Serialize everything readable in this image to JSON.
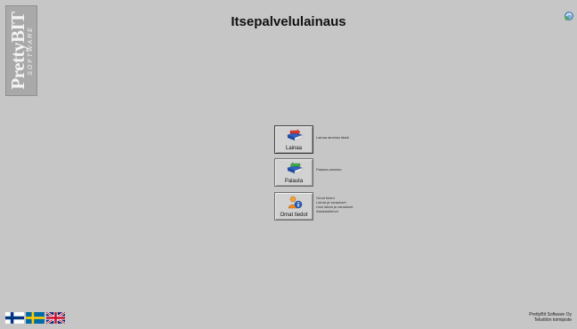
{
  "header": {
    "title": "Itsepalvelulainaus"
  },
  "logo": {
    "name": "PrettyBIT",
    "sub": "SOFTWARE",
    "icon": "prettybit-logo"
  },
  "toolbar": {
    "refresh_icon": "refresh-icon"
  },
  "actions": [
    {
      "label": "Lainaa",
      "icon": "book-arrow-icon",
      "description": [
        "Lainaa aineisto tästä"
      ]
    },
    {
      "label": "Palauta",
      "icon": "book-return-icon",
      "description": [
        "Palauta aineisto"
      ]
    },
    {
      "label": "Omat tiedot",
      "icon": "user-info-icon",
      "description": [
        "Omat tiedot",
        "Lainat ja varaukset",
        "Uusi lainat ja varaukset",
        "Asiakastietoni"
      ]
    }
  ],
  "languages": [
    {
      "code": "fi",
      "icon": "finland-flag-icon"
    },
    {
      "code": "sv",
      "icon": "sweden-flag-icon"
    },
    {
      "code": "en",
      "icon": "uk-flag-icon"
    }
  ],
  "footer": {
    "company": "PrettyBit Software Oy",
    "template": "Tekstitön toimipiste"
  },
  "colors": {
    "background": "#c6c6c6",
    "button": "#d2d2d2"
  }
}
